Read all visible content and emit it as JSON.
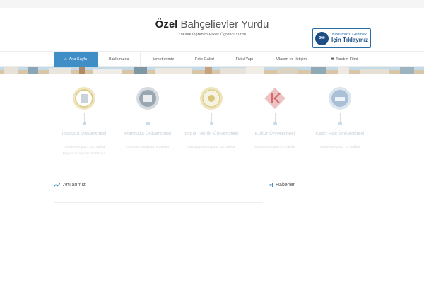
{
  "header": {
    "title_bold": "Özel",
    "title_rest": "Bahçelievler Yurdu",
    "subtitle": "Yüksek Öğrenim Erkek Öğrenci Yurdu",
    "tour": {
      "badge": "360",
      "line1": "Yurdumuzu Gezmek",
      "line2": "İçin Tıklayınız"
    }
  },
  "nav": {
    "items": [
      {
        "label": "Ana Sayfa",
        "icon": "home-icon",
        "active": true
      },
      {
        "label": "Hakkımızda",
        "icon": "",
        "active": false
      },
      {
        "label": "Hizmetlerimiz",
        "icon": "",
        "active": false
      },
      {
        "label": "Foto Galeri",
        "icon": "",
        "active": false
      },
      {
        "label": "Fiziki Yapı",
        "icon": "",
        "active": false
      },
      {
        "label": "Ulaşım ve İletişim",
        "icon": "",
        "active": false
      },
      {
        "label": "Tanıtım Filmi",
        "icon": "video-camera-icon",
        "active": false
      }
    ]
  },
  "universities": [
    {
      "name": "İstanbul Üniversitesi",
      "details": [
        "Avcılar Kampüsü: 16 Dakika",
        "Beyazıt Kampüsü: 45 Dakika"
      ],
      "logo_color": "#d9c67a"
    },
    {
      "name": "Marmara Üniversitesi",
      "details": [
        "Göztepe Kampüsü: 5 Dakika"
      ],
      "logo_color": "#9aa7b1"
    },
    {
      "name": "Yıldız Teknik Üniversitesi",
      "details": [
        "Davutpaşa Kampüsü: 15 Dakika"
      ],
      "logo_color": "#d9c67a"
    },
    {
      "name": "Kültür Üniversitesi",
      "details": [
        "Merkez Kampüsü: 5 Dakika"
      ],
      "logo_color": "#d66a6a"
    },
    {
      "name": "Kadir Has Üniversitesi",
      "details": [
        "Cibali Kampüsü: 15 Dakika"
      ],
      "logo_color": "#a9c0d6"
    }
  ],
  "sections": {
    "articles": "Artılarımız",
    "news": "Haberler"
  },
  "colors": {
    "accent": "#3f8ec6",
    "brand_dark": "#1d4f86"
  }
}
